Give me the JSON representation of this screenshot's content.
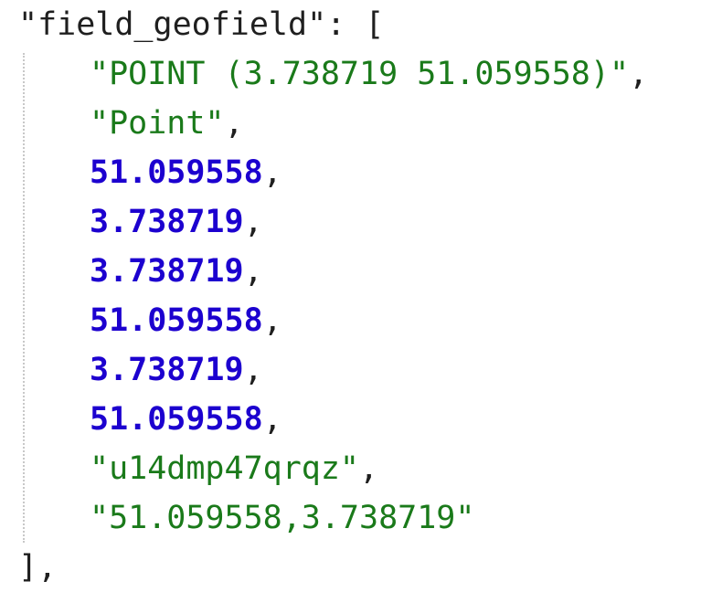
{
  "json_view": {
    "key": "\"field_geofield\"",
    "colon": ": ",
    "open_bracket": "[",
    "close_bracket": "],",
    "comma": ",",
    "items": [
      {
        "text": "\"POINT (3.738719 51.059558)\"",
        "type": "string",
        "trailing": ","
      },
      {
        "text": "\"Point\"",
        "type": "string",
        "trailing": ","
      },
      {
        "text": "51.059558",
        "type": "number",
        "trailing": ","
      },
      {
        "text": "3.738719",
        "type": "number",
        "trailing": ","
      },
      {
        "text": "3.738719",
        "type": "number",
        "trailing": ","
      },
      {
        "text": "51.059558",
        "type": "number",
        "trailing": ","
      },
      {
        "text": "3.738719",
        "type": "number",
        "trailing": ","
      },
      {
        "text": "51.059558",
        "type": "number",
        "trailing": ","
      },
      {
        "text": "\"u14dmp47qrqz\"",
        "type": "string",
        "trailing": ","
      },
      {
        "text": "\"51.059558,3.738719\"",
        "type": "string",
        "trailing": ""
      }
    ]
  },
  "colors": {
    "string": "#1a7a1a",
    "number": "#1c00cf",
    "punctuation": "#1f1f1f"
  }
}
